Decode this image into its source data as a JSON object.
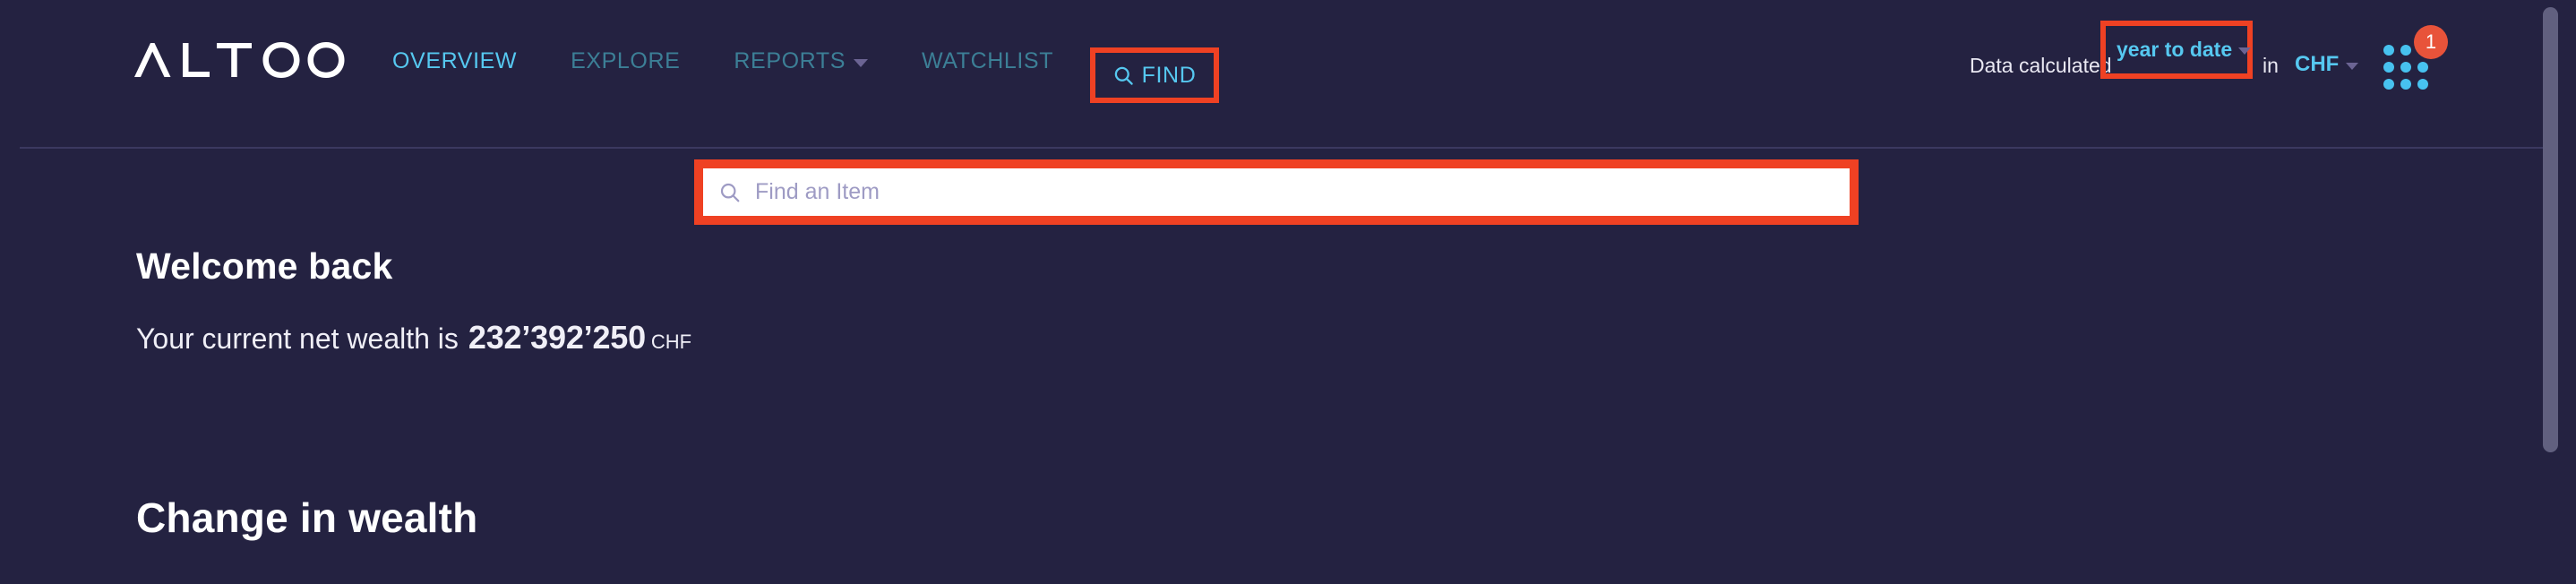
{
  "brand": {
    "name": "ALTOO"
  },
  "nav": {
    "items": [
      {
        "label": "OVERVIEW",
        "active": true,
        "has_caret": false
      },
      {
        "label": "EXPLORE",
        "active": false,
        "has_caret": false
      },
      {
        "label": "REPORTS",
        "active": false,
        "has_caret": true
      },
      {
        "label": "WATCHLIST",
        "active": false,
        "has_caret": false
      }
    ],
    "find_label": "FIND"
  },
  "header_right": {
    "calculated_label": "Data calculated",
    "period_value": "year to date",
    "in_label": "in",
    "currency_value": "CHF",
    "apps_badge_count": "1"
  },
  "search": {
    "placeholder": "Find an Item",
    "value": ""
  },
  "main": {
    "welcome_title": "Welcome back",
    "networth_lead": "Your current net wealth is",
    "networth_amount": "232’392’250",
    "networth_currency": "CHF",
    "section_title": "Change in wealth"
  },
  "colors": {
    "background": "#242241",
    "accent_cyan": "#56c8f0",
    "nav_inactive": "#3c7f96",
    "highlight_red": "#ef4123",
    "badge_red": "#e8533a",
    "dot_blue": "#47c2ef",
    "divider": "#3b3860",
    "scrollbar": "#61607f"
  }
}
